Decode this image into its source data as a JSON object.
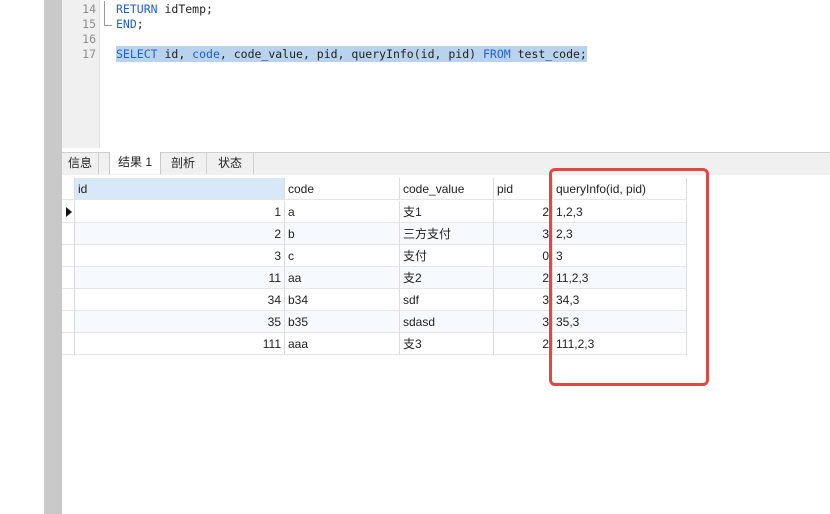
{
  "editor": {
    "lines": [
      {
        "num": "14",
        "fold": "mid",
        "tokens": [
          {
            "t": "RETURN",
            "k": "kw"
          },
          {
            "t": " idTemp;",
            "k": "tx"
          }
        ]
      },
      {
        "num": "15",
        "fold": "end",
        "tokens": [
          {
            "t": "END",
            "k": "kw"
          },
          {
            "t": ";",
            "k": "tx"
          }
        ]
      },
      {
        "num": "16",
        "fold": "",
        "tokens": []
      },
      {
        "num": "17",
        "fold": "",
        "selected": true,
        "tokens": [
          {
            "t": "SELECT",
            "k": "kw"
          },
          {
            "t": " id, ",
            "k": "tx"
          },
          {
            "t": "code",
            "k": "kw"
          },
          {
            "t": ", code_value, pid, queryInfo(id, pid) ",
            "k": "tx"
          },
          {
            "t": "FROM",
            "k": "kw"
          },
          {
            "t": " test_code;",
            "k": "tx"
          }
        ]
      }
    ]
  },
  "tabs": {
    "info": "信息",
    "result1": "结果 1",
    "profile": "剖析",
    "status": "状态"
  },
  "table": {
    "columns": [
      "id",
      "code",
      "code_value",
      "pid",
      "queryInfo(id, pid)"
    ],
    "rows": [
      [
        "1",
        "a",
        "支1",
        "2",
        "1,2,3"
      ],
      [
        "2",
        "b",
        "三方支付",
        "3",
        "2,3"
      ],
      [
        "3",
        "c",
        "支付",
        "0",
        "3"
      ],
      [
        "11",
        "aa",
        "支2",
        "2",
        "11,2,3"
      ],
      [
        "34",
        "b34",
        "sdf",
        "3",
        "34,3"
      ],
      [
        "35",
        "b35",
        "sdasd",
        "3",
        "35,3"
      ],
      [
        "111",
        "aaa",
        "支3",
        "2",
        "111,2,3"
      ]
    ]
  },
  "colors": {
    "keyword": "#1f5fd6",
    "selection": "#b9d3ee",
    "highlight_box": "#e04848"
  }
}
